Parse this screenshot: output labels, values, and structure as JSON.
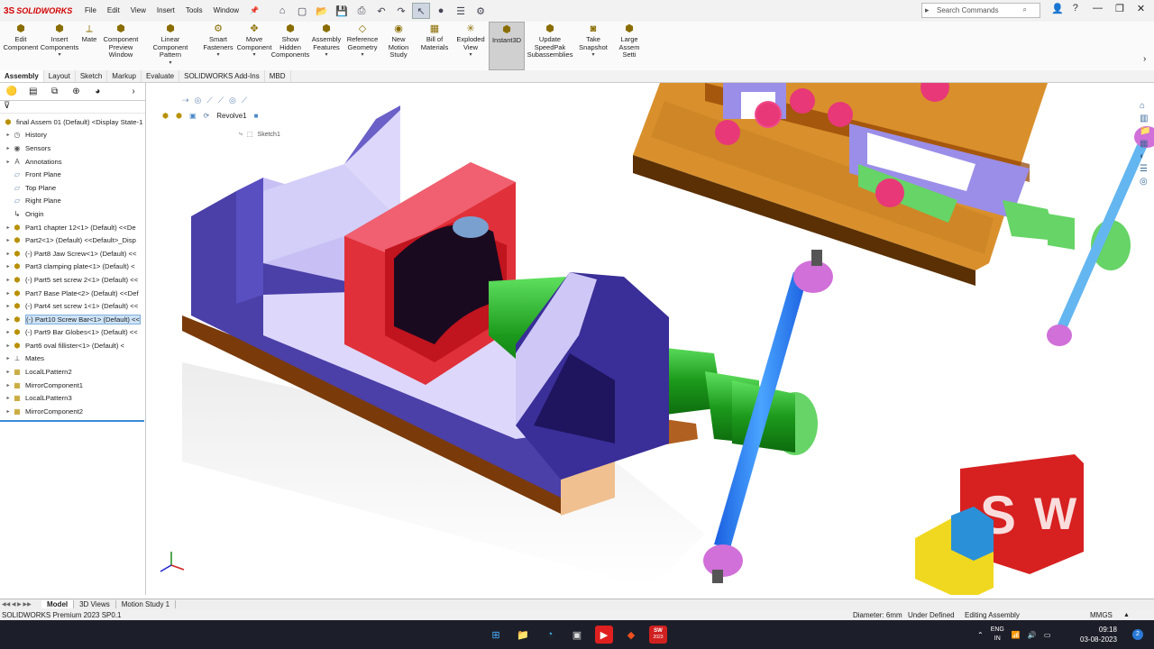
{
  "app": {
    "brand": "SOLIDWORKS"
  },
  "menu": [
    "File",
    "Edit",
    "View",
    "Insert",
    "Tools",
    "Window"
  ],
  "search": {
    "placeholder": "Search Commands"
  },
  "ribbon": [
    {
      "label": "Edit Component",
      "icon": "edit-component-icon"
    },
    {
      "label": "Insert Components",
      "icon": "insert-components-icon"
    },
    {
      "label": "Mate",
      "icon": "mate-icon"
    },
    {
      "label": "Component Preview Window",
      "icon": "preview-window-icon"
    },
    {
      "label": "Linear Component Pattern",
      "icon": "linear-pattern-icon"
    },
    {
      "label": "Smart Fasteners",
      "icon": "smart-fasteners-icon"
    },
    {
      "label": "Move Component",
      "icon": "move-component-icon"
    },
    {
      "label": "Show Hidden Components",
      "icon": "show-hidden-icon"
    },
    {
      "label": "Assembly Features",
      "icon": "assembly-features-icon"
    },
    {
      "label": "Reference Geometry",
      "icon": "reference-geometry-icon"
    },
    {
      "label": "New Motion Study",
      "icon": "motion-study-icon"
    },
    {
      "label": "Bill of Materials",
      "icon": "bom-icon"
    },
    {
      "label": "Exploded View",
      "icon": "exploded-view-icon"
    },
    {
      "label": "Instant3D",
      "icon": "instant3d-icon"
    },
    {
      "label": "Update SpeedPak Subassemblies",
      "icon": "speedpak-icon"
    },
    {
      "label": "Take Snapshot",
      "icon": "snapshot-icon"
    },
    {
      "label": "Large Assem Setti",
      "icon": "large-assembly-icon"
    }
  ],
  "tabs": [
    "Assembly",
    "Layout",
    "Sketch",
    "Markup",
    "Evaluate",
    "SOLIDWORKS Add-Ins",
    "MBD"
  ],
  "tree": [
    {
      "label": "final Assem 01 (Default) <Display State-1",
      "icon": "assembly-icon"
    },
    {
      "label": "History",
      "icon": "history-icon"
    },
    {
      "label": "Sensors",
      "icon": "sensors-icon"
    },
    {
      "label": "Annotations",
      "icon": "annotations-icon"
    },
    {
      "label": "Front Plane",
      "icon": "plane-icon"
    },
    {
      "label": "Top Plane",
      "icon": "plane-icon"
    },
    {
      "label": "Right Plane",
      "icon": "plane-icon"
    },
    {
      "label": "Origin",
      "icon": "origin-icon"
    },
    {
      "label": "Part1 chapter 12<1> (Default) <<De",
      "icon": "part-icon"
    },
    {
      "label": "Part2<1> (Default) <<Default>_Disp",
      "icon": "part-icon"
    },
    {
      "label": "(-) Part8 Jaw Screw<1> (Default) <<",
      "icon": "part-icon"
    },
    {
      "label": "Part3 clamping plate<1> (Default) <",
      "icon": "part-icon"
    },
    {
      "label": "(-) Part5 set screw 2<1> (Default) <<",
      "icon": "part-icon"
    },
    {
      "label": "Part7 Base Plate<2> (Default) <<Def",
      "icon": "part-icon"
    },
    {
      "label": "(-) Part4 set screw 1<1> (Default) <<",
      "icon": "part-icon"
    },
    {
      "label": "(-) Part10 Screw Bar<1> (Default) <<",
      "icon": "part-icon"
    },
    {
      "label": "(-) Part9 Bar Globes<1> (Default) <<",
      "icon": "part-icon"
    },
    {
      "label": "Part6 oval fillister<1> (Default) <",
      "icon": "part-icon"
    },
    {
      "label": "Mates",
      "icon": "mates-icon"
    },
    {
      "label": "LocalLPattern2",
      "icon": "pattern-icon"
    },
    {
      "label": "MirrorComponent1",
      "icon": "mirror-icon"
    },
    {
      "label": "LocalLPattern3",
      "icon": "pattern-icon"
    },
    {
      "label": "MirrorComponent2",
      "icon": "mirror-icon"
    }
  ],
  "feature": {
    "name": "Revolve1",
    "sketch": "Sketch1"
  },
  "bottom_tabs": [
    "Model",
    "3D Views",
    "Motion Study 1"
  ],
  "status": {
    "product": "SOLIDWORKS Premium 2023 SP0.1",
    "diameter": "Diameter: 6mm",
    "defined": "Under Defined",
    "mode": "Editing Assembly",
    "units": "MMGS"
  },
  "taskbar": {
    "lang1": "ENG",
    "lang2": "IN",
    "time": "09:18",
    "date": "03-08-2023",
    "sw_badge": "2023"
  }
}
